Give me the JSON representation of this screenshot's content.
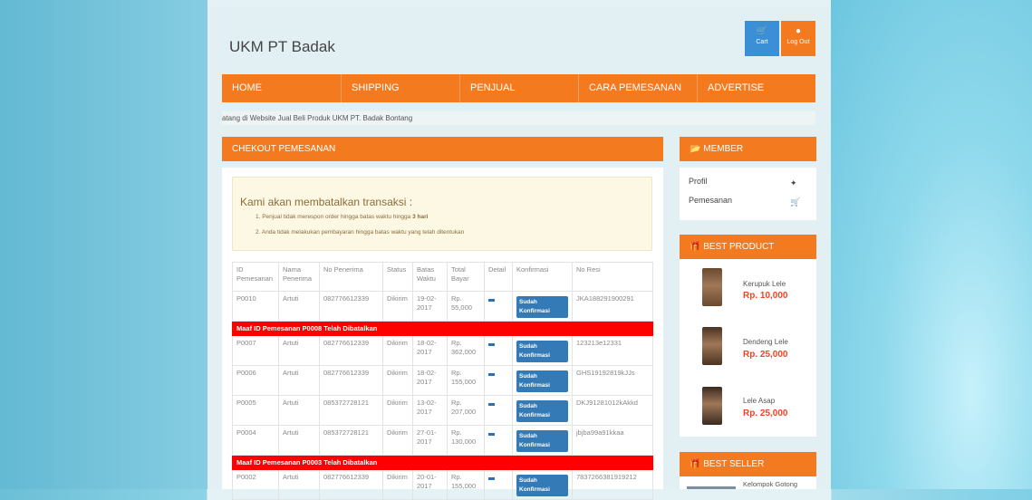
{
  "header": {
    "site_title": "UKM PT Badak",
    "cart_label": "Cart",
    "cart_icon": "cart-icon",
    "logout_label": "Log Out",
    "logout_icon": "user-icon"
  },
  "nav": {
    "items": [
      "HOME",
      "SHIPPING",
      "PENJUAL",
      "CARA PEMESANAN",
      "ADVERTISE"
    ]
  },
  "marquee_text": "atang di Website Jual Beli Produk UKM PT. Badak Bontang",
  "checkout": {
    "heading": "CHEKOUT PEMESANAN",
    "alert": {
      "title": "Kami akan membatalkan transaksi :",
      "item1": "1. Penjual tidak merespon order hingga batas waktu hingga",
      "item1_bold": "3 hari",
      "item2": "2. Anda tidak melakukan pembayaran hingga batas waktu yang telah ditentukan"
    },
    "columns": [
      "ID Pemesanan",
      "Nama Penerima",
      "No Penerima",
      "Status",
      "Batas Waktu",
      "Total Bayar",
      "Detail",
      "Konfirmasi",
      "No Resi"
    ],
    "rows": [
      {
        "type": "order",
        "id": "P0010",
        "nama": "Artuti",
        "no": "082776612339",
        "status": "Dikirim",
        "batas": "19-02-2017",
        "total": "Rp. 55,000",
        "konfirmasi": "Sudah Konfirmasi",
        "resi": "JKA188291900291"
      },
      {
        "type": "cancel",
        "message": "Maaf ID Pemesanan P0008 Telah Dibatalkan"
      },
      {
        "type": "order",
        "id": "P0007",
        "nama": "Artuti",
        "no": "082776612339",
        "status": "Dikirim",
        "batas": "18-02-2017",
        "total": "Rp. 362,000",
        "konfirmasi": "Sudah Konfirmasi",
        "resi": "123213e12331"
      },
      {
        "type": "order",
        "id": "P0006",
        "nama": "Artuti",
        "no": "082776612339",
        "status": "Dikirim",
        "batas": "18-02-2017",
        "total": "Rp. 155,000",
        "konfirmasi": "Sudah Konfirmasi",
        "resi": "GHS19192819kJJs"
      },
      {
        "type": "order",
        "id": "P0005",
        "nama": "Artuti",
        "no": "085372728121",
        "status": "Dikirim",
        "batas": "13-02-2017",
        "total": "Rp. 207,000",
        "konfirmasi": "Sudah Konfirmasi",
        "resi": "DKJ91281012kAkkd"
      },
      {
        "type": "order",
        "id": "P0004",
        "nama": "Artuti",
        "no": "085372728121",
        "status": "Dikirim",
        "batas": "27-01-2017",
        "total": "Rp. 130,000",
        "konfirmasi": "Sudah Konfirmasi",
        "resi": "jbjba99a91kkaa"
      },
      {
        "type": "cancel",
        "message": "Maaf ID Pemesanan P0003 Telah Dibatalkan"
      },
      {
        "type": "order",
        "id": "P0002",
        "nama": "Artuti",
        "no": "082776612339",
        "status": "Dikirim",
        "batas": "20-01-2017",
        "total": "Rp. 155,000",
        "konfirmasi": "Sudah Konfirmasi",
        "resi": "7837266381919212"
      }
    ]
  },
  "member": {
    "heading": "MEMBER",
    "heading_icon": "folder-open-icon",
    "items": [
      {
        "label": "Profil",
        "icon": "person-icon"
      },
      {
        "label": "Pemesanan",
        "icon": "cart-icon"
      }
    ]
  },
  "best_product": {
    "heading": "BEST PRODUCT",
    "heading_icon": "gift-icon",
    "items": [
      {
        "name": "Kerupuk Lele",
        "price": "Rp. 10,000",
        "color": "#6a4a2e"
      },
      {
        "name": "Dendeng Lele",
        "price": "Rp. 25,000",
        "color": "#4a3322"
      },
      {
        "name": "Lele Asap",
        "price": "Rp. 25,000",
        "color": "#3a2a20"
      }
    ]
  },
  "best_seller": {
    "heading": "BEST SELLER",
    "heading_icon": "gift-icon",
    "items": [
      {
        "name": "Kelompok Gotong"
      }
    ]
  },
  "colors": {
    "accent": "#f47a20",
    "cart_button": "#3a8fd6",
    "cancel_row": "#ff0000",
    "price": "#ee4422",
    "confirm_badge": "#337ab7"
  }
}
